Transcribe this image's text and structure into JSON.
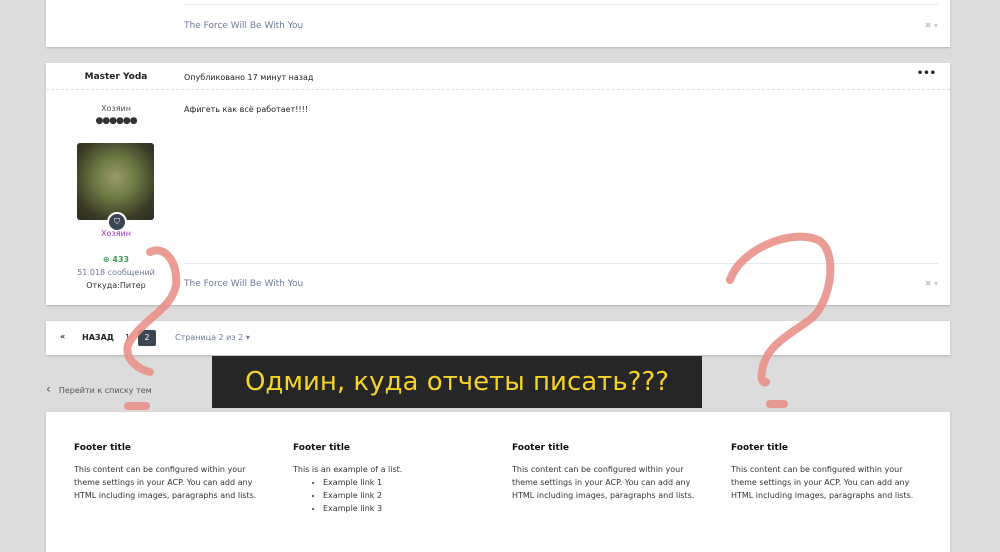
{
  "prev_post": {
    "signature": "The Force Will Be With You"
  },
  "post": {
    "author": "Master Yoda",
    "published": "Опубликовано 17 минут назад",
    "more_icon": "ellipsis-icon",
    "rank_title": "Хозяин",
    "rank_pips": "●●●●●●",
    "group": "Хозяин",
    "reputation": "433",
    "posts_count": "51 018 сообщений",
    "location": "Откуда:Питер",
    "content": "Афигеть как всё работает!!!!",
    "signature": "The Force Will Be With You"
  },
  "pagination": {
    "first_icon": "«",
    "prev_label": "НАЗАД",
    "pages": [
      "1",
      "2"
    ],
    "current": "2",
    "page_info": "Страница 2 из 2"
  },
  "back_link": "Перейти к списку тем",
  "caption": "Одмин, куда отчеты писать???",
  "footer": {
    "columns": [
      {
        "title": "Footer title",
        "text": "This content can be configured within your theme settings in your ACP. You can add any HTML including images, paragraphs and lists."
      },
      {
        "title": "Footer title",
        "text": "This is an example of a list.",
        "links": [
          "Example link 1",
          "Example link 2",
          "Example link 3"
        ]
      },
      {
        "title": "Footer title",
        "text": "This content can be configured within your theme settings in your ACP. You can add any HTML including images, paragraphs and lists."
      },
      {
        "title": "Footer title",
        "text": "This content can be configured within your theme settings in your ACP. You can add any HTML including images, paragraphs and lists."
      }
    ]
  },
  "colors": {
    "accent": "#6d7a95",
    "reputation": "#3b9a5a",
    "group": "#9b30c0",
    "annotation": "#e8918a",
    "caption_text": "#f5d327"
  }
}
